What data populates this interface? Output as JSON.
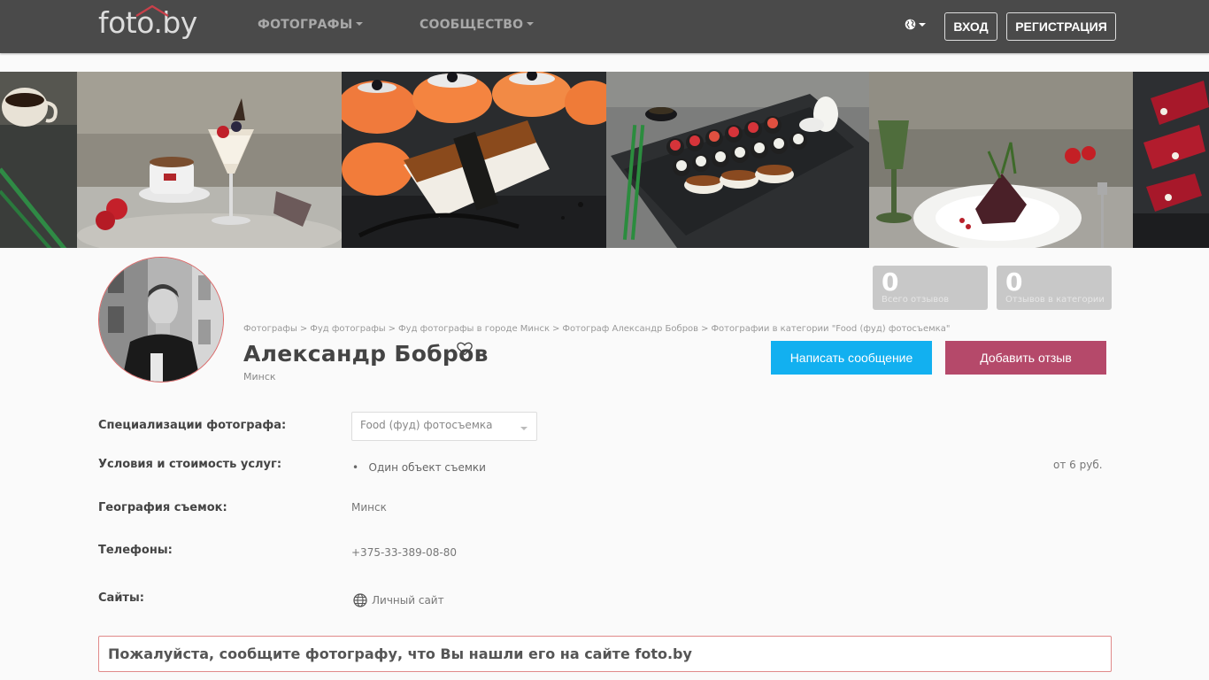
{
  "header": {
    "logo": "foto.by",
    "nav": [
      {
        "label": "ФОТОГРАФЫ"
      },
      {
        "label": "СООБЩЕСТВО"
      }
    ],
    "login_label": "ВХОД",
    "register_label": "РЕГИСТРАЦИЯ"
  },
  "profile": {
    "breadcrumb": [
      "Фотографы",
      "Фуд фотографы",
      "Фуд фотографы в городе Минск",
      "Фотограф Александр Бобров",
      "Фотографии в категории \"Food (фуд) фотосъемка\""
    ],
    "breadcrumb_separator": ">",
    "name": "Александр Бобров",
    "city": "Минск"
  },
  "stats": [
    {
      "value": "0",
      "label": "Всего отзывов"
    },
    {
      "value": "0",
      "label": "Отзывов в категории"
    }
  ],
  "actions": {
    "message_label": "Написать сообщение",
    "review_label": "Добавить отзыв"
  },
  "details": {
    "specializations": {
      "label": "Специализации фотографа:",
      "selected": "Food (фуд) фотосъемка"
    },
    "pricing": {
      "label": "Условия и стоимость услуг:",
      "item": "Один объект съемки",
      "price": "от 6 руб."
    },
    "geography": {
      "label": "География съемок:",
      "value": "Минск"
    },
    "phones": {
      "label": "Телефоны:",
      "value": "+375-33-389-08-80"
    },
    "sites": {
      "label": "Сайты:",
      "link": "Личный сайт"
    }
  },
  "notice": "Пожалуйста, сообщите фотографу, что Вы нашли его на сайте foto.by",
  "colors": {
    "navbar": "#4a4a4a",
    "message_button": "#12b0f0",
    "review_button": "#b5496a",
    "stat_box": "#c8c8c8",
    "notice_border": "#e08a8a"
  }
}
